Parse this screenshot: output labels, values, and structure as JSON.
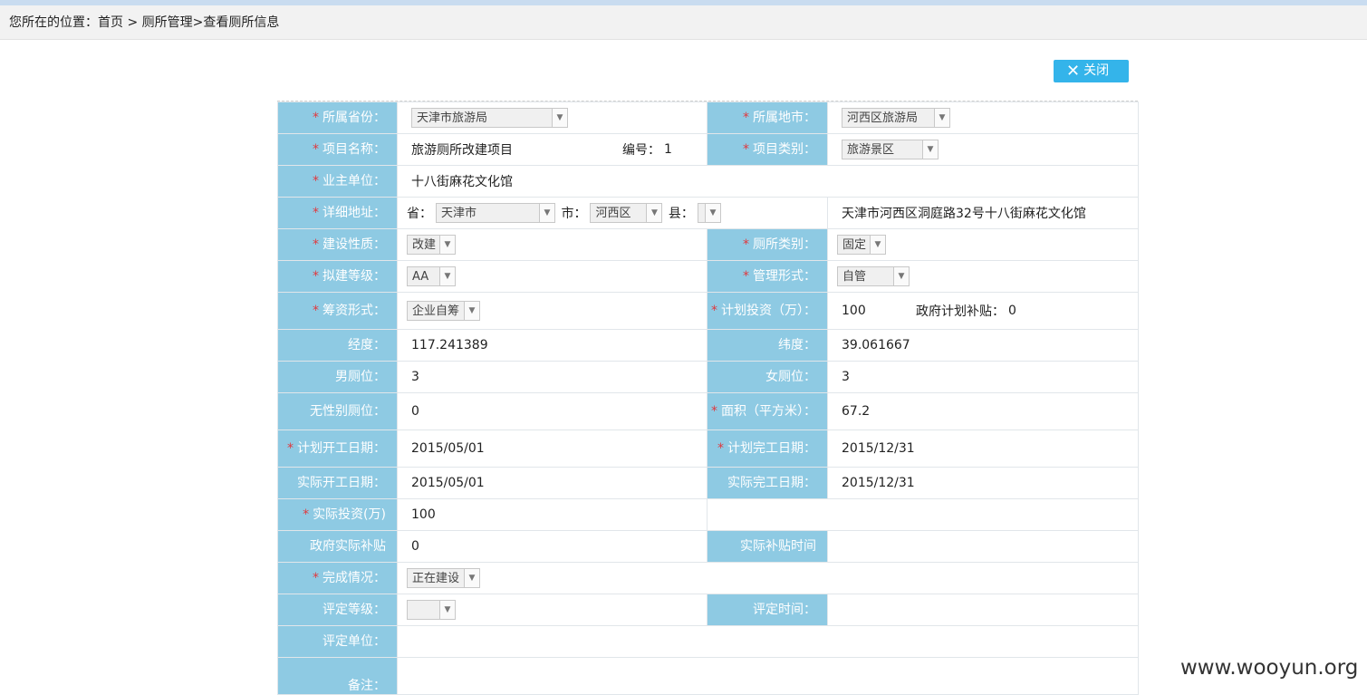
{
  "breadcrumb": {
    "prefix": "您所在的位置：",
    "home": "首页",
    "sep1": " > ",
    "section": "厕所管理",
    "sep2": ">",
    "current": "查看厕所信息"
  },
  "close_label": "关闭",
  "form": {
    "province_label": "所属省份：",
    "province_value": "天津市旅游局",
    "city_label": "所属地市：",
    "city_value": "河西区旅游局",
    "project_name_label": "项目名称：",
    "project_name_value": "旅游厕所改建项目",
    "number_label": "编号：",
    "number_value": "1",
    "project_type_label": "项目类别：",
    "project_type_value": "旅游景区",
    "owner_label": "业主单位：",
    "owner_value": "十八街麻花文化馆",
    "address_label": "详细地址：",
    "addr_prov_label": "省：",
    "addr_prov_value": "天津市",
    "addr_city_label": "市：",
    "addr_city_value": "河西区",
    "addr_county_label": "县：",
    "addr_county_value": "",
    "address_detail": "天津市河西区洞庭路32号十八街麻花文化馆",
    "build_nature_label": "建设性质：",
    "build_nature_value": "改建",
    "toilet_type_label": "厕所类别：",
    "toilet_type_value": "固定",
    "grade_label": "拟建等级：",
    "grade_value": "AA",
    "manage_label": "管理形式：",
    "manage_value": "自管",
    "funding_label": "筹资形式：",
    "funding_value": "企业自筹",
    "plan_invest_label": "计划投资（万）：",
    "plan_invest_value": "100",
    "gov_plan_subsidy_label": "政府计划补贴：",
    "gov_plan_subsidy_value": "0",
    "longitude_label": "经度：",
    "longitude_value": "117.241389",
    "latitude_label": "纬度：",
    "latitude_value": "39.061667",
    "male_label": "男厕位：",
    "male_value": "3",
    "female_label": "女厕位：",
    "female_value": "3",
    "neutral_label": "无性别厕位：",
    "neutral_value": "0",
    "area_label": "面积（平方米）：",
    "area_value": "67.2",
    "plan_start_label": "计划开工日期：",
    "plan_start_value": "2015/05/01",
    "plan_end_label": "计划完工日期：",
    "plan_end_value": "2015/12/31",
    "actual_start_label": "实际开工日期：",
    "actual_start_value": "2015/05/01",
    "actual_end_label": "实际完工日期：",
    "actual_end_value": "2015/12/31",
    "actual_invest_label": "实际投资(万)",
    "actual_invest_value": "100",
    "gov_actual_subsidy_label": "政府实际补贴",
    "gov_actual_subsidy_value": "0",
    "subsidy_time_label": "实际补贴时间",
    "subsidy_time_value": "",
    "completion_label": "完成情况：",
    "completion_value": "正在建设",
    "eval_grade_label": "评定等级：",
    "eval_grade_value": "",
    "eval_time_label": "评定时间：",
    "eval_time_value": "",
    "eval_unit_label": "评定单位：",
    "eval_unit_value": "",
    "remark_label": "备注：",
    "remark_value": ""
  },
  "required_mark": "*",
  "dropdown_arrow": "▼",
  "watermark": "www.wooyun.org",
  "colors": {
    "label_bg": "#8ecae3",
    "button_bg": "#34b4ea",
    "required": "#e0393e"
  }
}
